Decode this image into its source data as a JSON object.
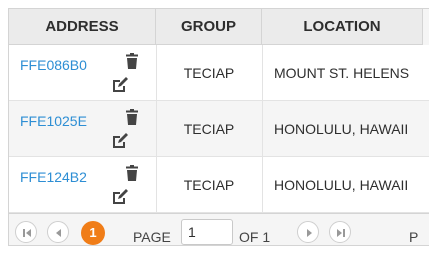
{
  "columns": {
    "address": "ADDRESS",
    "group": "GROUP",
    "location": "LOCATION"
  },
  "rows": [
    {
      "address": "FFE086B0",
      "group": "TECIAP",
      "location": "MOUNT ST. HELENS"
    },
    {
      "address": "FFE1025E",
      "group": "TECIAP",
      "location": "HONOLULU, HAWAII"
    },
    {
      "address": "FFE124B2",
      "group": "TECIAP",
      "location": "HONOLULU, HAWAII"
    }
  ],
  "pager": {
    "current_page": "1",
    "page_label": "PAGE",
    "page_input": "1",
    "of_label": "OF 1",
    "trailing_label": "P"
  },
  "colors": {
    "link": "#2d8ed4",
    "accent": "#f07d18",
    "header_bg": "#ebebeb"
  },
  "icons": {
    "delete": "trash-icon",
    "edit": "edit-icon",
    "first": "first-page-icon",
    "prev": "prev-page-icon",
    "next": "next-page-icon",
    "last": "last-page-icon"
  }
}
